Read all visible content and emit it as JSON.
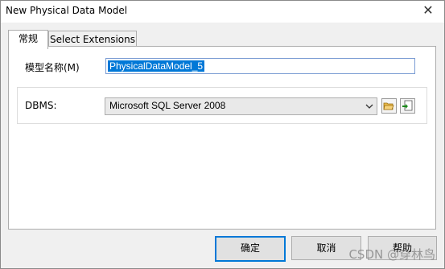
{
  "window": {
    "title": "New Physical Data Model",
    "close_glyph": "✕"
  },
  "tabs": [
    {
      "label": "常规",
      "active": true
    },
    {
      "label": "Select Extensions",
      "active": false
    }
  ],
  "form": {
    "model_name_label": "模型名称(M)",
    "model_name_value": "PhysicalDataModel_5",
    "dbms_label": "DBMS:",
    "dbms_value": "Microsoft SQL Server 2008",
    "dbms_icons": [
      "folder-open-icon",
      "import-icon"
    ]
  },
  "buttons": {
    "ok": "确定",
    "cancel": "取消",
    "help": "帮助"
  },
  "watermark": "CSDN @穿林鸟",
  "colors": {
    "accent": "#0078d7",
    "selection": "#0078d7"
  }
}
